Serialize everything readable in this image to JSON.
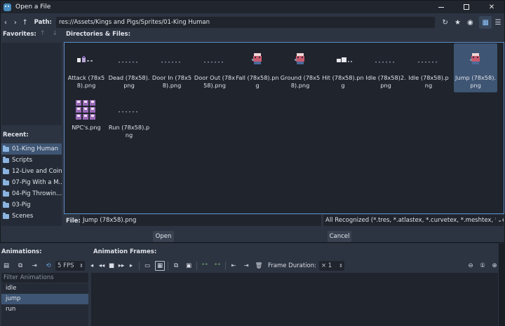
{
  "dialog": {
    "title": "Open a File",
    "path_label": "Path:",
    "path_value": "res://Assets/Kings and Pigs/Sprites/01-King Human",
    "favorites_label": "Favorites:",
    "dirs_label": "Directories & Files:",
    "recent_label": "Recent:",
    "file_label": "File:",
    "file_value": "Jump (78x58).png",
    "filter_value": "All Recognized (*.tres, *.atlastex, *.curvetex, *.meshtex, *.res, ...)",
    "open_label": "Open",
    "cancel_label": "Cancel"
  },
  "files": [
    {
      "name": "Attack (78x58).png",
      "selected": false,
      "thumb": "attack"
    },
    {
      "name": "Dead (78x58).png",
      "selected": false,
      "thumb": "dots"
    },
    {
      "name": "Door In (78x58).png",
      "selected": false,
      "thumb": "dots"
    },
    {
      "name": "Door Out (78x58).png",
      "selected": false,
      "thumb": "dots"
    },
    {
      "name": "Fall (78x58).png",
      "selected": false,
      "thumb": "king"
    },
    {
      "name": "Ground (78x58).png",
      "selected": false,
      "thumb": "king"
    },
    {
      "name": "Hit (78x58).png",
      "selected": false,
      "thumb": "hit"
    },
    {
      "name": "Idle (78x58)2.png",
      "selected": false,
      "thumb": "dots"
    },
    {
      "name": "Idle (78x58).png",
      "selected": false,
      "thumb": "dots"
    },
    {
      "name": "Jump (78x58).png",
      "selected": true,
      "thumb": "king"
    },
    {
      "name": "NPC's.png",
      "selected": false,
      "thumb": "npc"
    },
    {
      "name": "Run (78x58).png",
      "selected": false,
      "thumb": "dots"
    }
  ],
  "recent": [
    {
      "label": "01-King Human",
      "selected": true
    },
    {
      "label": "Scripts",
      "selected": false
    },
    {
      "label": "12-Live and Coins",
      "selected": false
    },
    {
      "label": "07-Pig With a M...",
      "selected": false
    },
    {
      "label": "04-Pig Throwin...",
      "selected": false
    },
    {
      "label": "03-Pig",
      "selected": false
    },
    {
      "label": "Scenes",
      "selected": false
    }
  ],
  "animation": {
    "animations_label": "Animations:",
    "frames_label": "Animation Frames:",
    "fps_value": "5 FPS",
    "filter_placeholder": "Filter Animations",
    "frame_duration_label": "Frame Duration:",
    "frame_duration_value": "× 1",
    "items": [
      {
        "label": "idle",
        "selected": false
      },
      {
        "label": "jump",
        "selected": true
      },
      {
        "label": "run",
        "selected": false
      }
    ]
  }
}
